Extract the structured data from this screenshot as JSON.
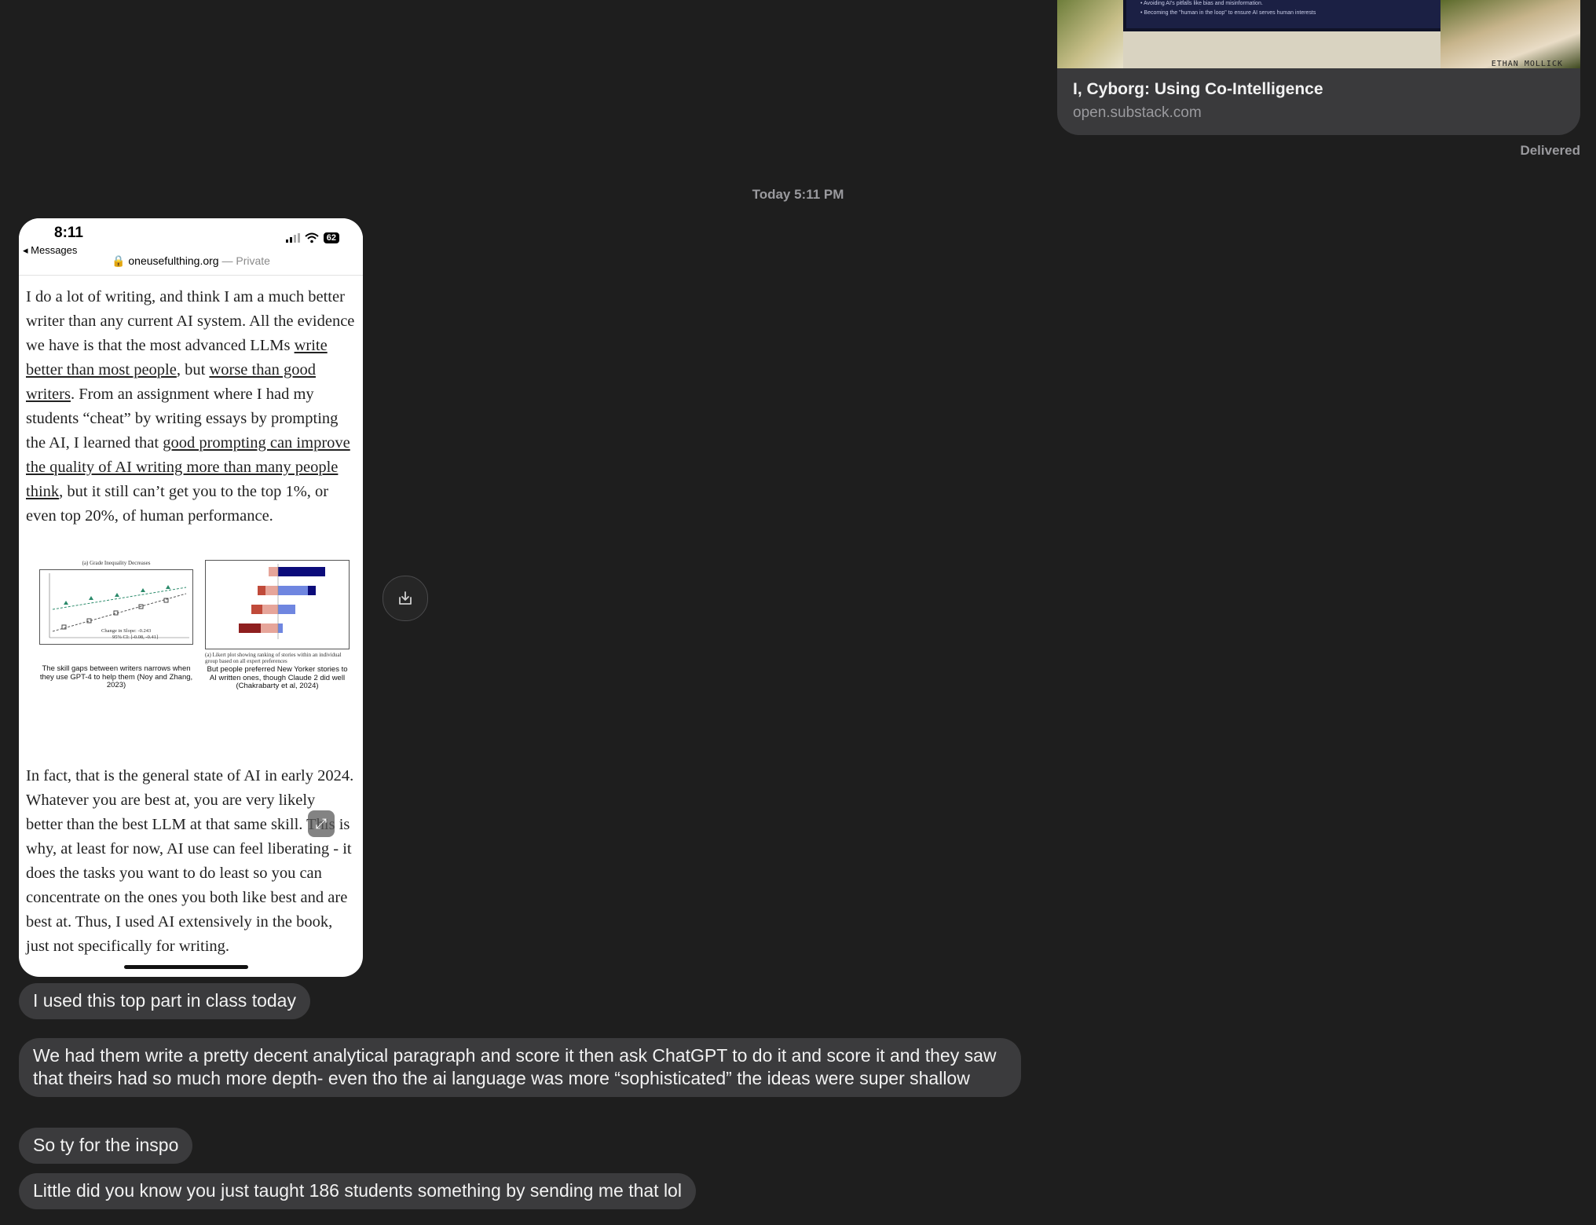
{
  "link_preview": {
    "thumb_bullet_1": "• Avoiding AI's pitfalls like bias and misinformation.",
    "thumb_bullet_2": "• Becoming the \"human in the loop\" to ensure AI serves human interests",
    "thumb_author": "ETHAN MOLLICK",
    "title": "I, Cyborg: Using Co-Intelligence",
    "domain": "open.substack.com"
  },
  "status": "Delivered",
  "timestamp": "Today 5:11 PM",
  "screenshot": {
    "time": "8:11",
    "back": "◂ Messages",
    "url": "oneusefulthing.org",
    "url_private": " — Private",
    "battery": "62",
    "para1": {
      "a": "I do a lot of writing, and think I am a much better writer than any current AI system. All the evidence we have is that the most advanced LLMs ",
      "link1": "write better than most people",
      "b": ", but ",
      "link2": "worse than good writers",
      "c": ". From an assignment where I had my students “cheat” by writing essays by prompting the AI, I learned that ",
      "link3": "good prompting can improve the quality of AI writing more than many people think",
      "d": ", but it still can’t get you to the top 1%, or even top 20%, of human performance."
    },
    "fig1": {
      "title": "(a) Grade Inequality Decreases",
      "slope_label": "Change in Slope:  -0.243",
      "ci_label": "95% CI: [-0.08, -0.41]",
      "caption": "The skill gaps between writers narrows when they use GPT-4 to help them (Noy and Zhang, 2023)"
    },
    "fig2": {
      "subcaption": "(a) Likert plot showing ranking of stories within an individual group based on all expert preferences",
      "caption": "But people preferred New Yorker stories to AI written ones, though Claude 2 did well (Chakrabarty et al, 2024)"
    },
    "para2": "In fact, that is the general state of AI in early 2024. Whatever you are best at, you are very likely better than the best LLM at that same skill. This is why, at least for now, AI use can feel liberating - it does the tasks you want to do least so you can concentrate on the ones you both like best and are best at. Thus, I used AI extensively in the book, just not specifically for writing."
  },
  "messages": [
    "I used this top part in class today",
    "We had them write a pretty decent analytical paragraph and score it then ask ChatGPT to do it and score it and they saw that theirs had so much more depth-  even tho the ai language was more “sophisticated” the ideas were super shallow",
    "So ty for the inspo",
    "Little did you know you just taught 186 students something by sending me that lol"
  ]
}
